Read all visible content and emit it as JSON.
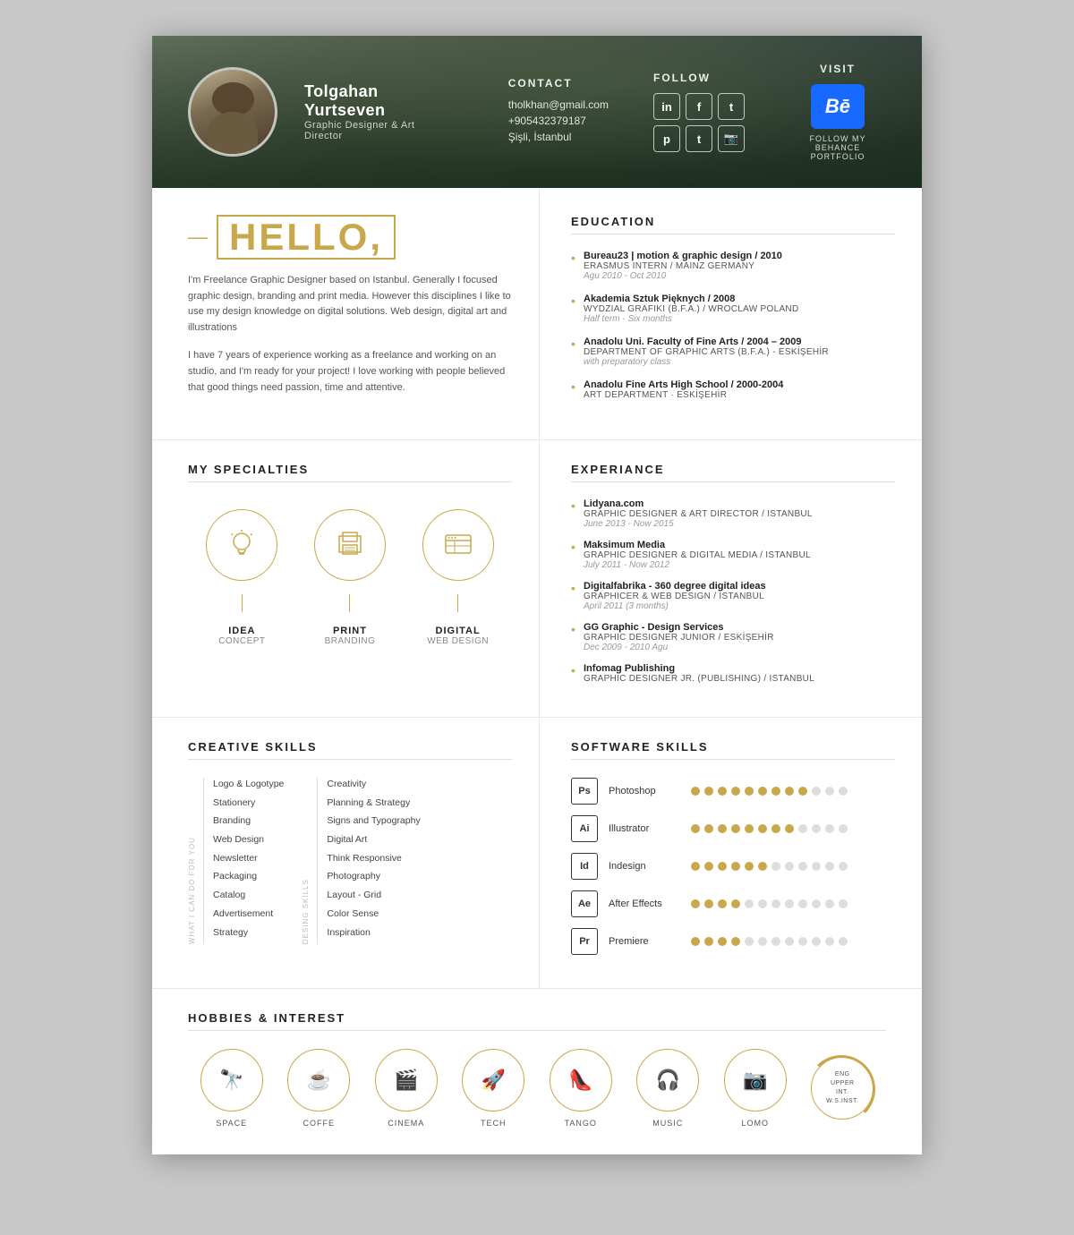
{
  "header": {
    "name": "Tolgahan Yurtseven",
    "title": "Graphic Designer & Art Director",
    "contact": {
      "label": "Contact",
      "email": "tholkhan@gmail.com",
      "phone": "+905432379187",
      "location": "Şişli, İstanbul"
    },
    "follow": {
      "label": "Follow",
      "socials": [
        "in",
        "f",
        "t",
        "p",
        "t",
        "📷"
      ]
    },
    "visit": {
      "label": "Visit",
      "behance_label": "Bē",
      "behance_text": "FOLLOW MY\nBEHANCE PORTFOLIO"
    }
  },
  "hello": {
    "title": "HELLO,",
    "bio1": "I'm Freelance Graphic Designer based on Istanbul. Generally I focused graphic design, branding and print media. However this disciplines I like to use my design knowledge on digital solutions. Web design, digital art and illustrations",
    "bio2": "I have 7 years of experience working as a freelance and working on an studio, and I'm ready for your project! I love working with people believed that good things need passion, time and attentive."
  },
  "education": {
    "heading": "EDUCATION",
    "items": [
      {
        "main": "Bureau23 | motion & graphic design / 2010",
        "sub": "ERASMUS INTERN / MAINZ GERMANY",
        "period": "Agu 2010 - Oct 2010"
      },
      {
        "main": "Akademia Sztuk Pięknych / 2008",
        "sub": "WYDZIAL GRAFIKI (B.F.A.) / WROCLAW POLAND",
        "period": "Half term - Six months"
      },
      {
        "main": "Anadolu Uni. Faculty of Fine Arts / 2004 – 2009",
        "sub": "DEPARTMENT OF GRAPHIC ARTS (B.F.A.) - ESKİŞEHİR",
        "period": "with preparatory class"
      },
      {
        "main": "Anadolu Fine Arts High School / 2000-2004",
        "sub": "ART DEPARTMENT · ESKİŞEHİR",
        "period": ""
      }
    ]
  },
  "specialties": {
    "heading": "MY SPECIALTIES",
    "items": [
      {
        "icon": "💡",
        "main": "IDEA",
        "sub": "CONCEPT"
      },
      {
        "icon": "🖨",
        "main": "PRINT",
        "sub": "BRANDING"
      },
      {
        "icon": "🖥",
        "main": "DIGITAL",
        "sub": "WEB DESIGN"
      }
    ]
  },
  "experience": {
    "heading": "EXPERIANCE",
    "items": [
      {
        "company": "Lidyana.com",
        "role": "GRAPHIC DESIGNER & ART DIRECTOR / ISTANBUL",
        "period": "June 2013 - Now 2015"
      },
      {
        "company": "Maksimum Media",
        "role": "GRAPHIC DESIGNER & DIGITAL MEDIA / ISTANBUL",
        "period": "July 2011 - Now 2012"
      },
      {
        "company": "Digitalfabrika - 360 degree digital ideas",
        "role": "GRAPHICER & WEB DESIGN / ISTANBUL",
        "period": "April 2011 (3 months)"
      },
      {
        "company": "GG Graphic - Design Services",
        "role": "GRAPHIC DESIGNER JUNIOR / ESKİŞEHİR",
        "period": "Dec 2009 - 2010 Agu"
      },
      {
        "company": "Infomag Publishing",
        "role": "GRAPHIC DESIGNER JR. (PUBLISHING) / ISTANBUL",
        "period": ""
      }
    ]
  },
  "creative_skills": {
    "heading": "CREATIVE SKILLS",
    "col1_label": "WHAT I CAN DO FOR YOU",
    "col1": [
      "Logo & Logotype",
      "Stationery",
      "Branding",
      "Web Design",
      "Newsletter",
      "Packaging",
      "Catalog",
      "Advertisement",
      "Strategy"
    ],
    "col2_label": "DESING SKILLS",
    "col2": [
      "Creativity",
      "Planning & Strategy",
      "Signs and Typography",
      "Digital Art",
      "Think Responsive",
      "Photography",
      "Layout - Grid",
      "Color Sense",
      "Inspiration"
    ]
  },
  "software_skills": {
    "heading": "SOFTWARE SKILLS",
    "items": [
      {
        "icon": "Ps",
        "name": "Photoshop",
        "filled": 9,
        "total": 12
      },
      {
        "icon": "Ai",
        "name": "Illustrator",
        "filled": 8,
        "total": 12
      },
      {
        "icon": "Id",
        "name": "Indesign",
        "filled": 6,
        "total": 12
      },
      {
        "icon": "Ae",
        "name": "After Effects",
        "filled": 4,
        "total": 12
      },
      {
        "icon": "Pr",
        "name": "Premiere",
        "filled": 4,
        "total": 12
      }
    ]
  },
  "hobbies": {
    "heading": "HOBBIES & INTEREST",
    "items": [
      {
        "icon": "🔭",
        "label": "SPACE"
      },
      {
        "icon": "☕",
        "label": "COFFE"
      },
      {
        "icon": "🎬",
        "label": "CINEMA"
      },
      {
        "icon": "🚀",
        "label": "TECH"
      },
      {
        "icon": "👠",
        "label": "TANGO"
      },
      {
        "icon": "🎧",
        "label": "MUSIC"
      },
      {
        "icon": "📷",
        "label": "LOMO"
      }
    ],
    "language": {
      "lines": [
        "ENG",
        "UPPER",
        "INT.",
        "W.S.INST."
      ]
    }
  }
}
